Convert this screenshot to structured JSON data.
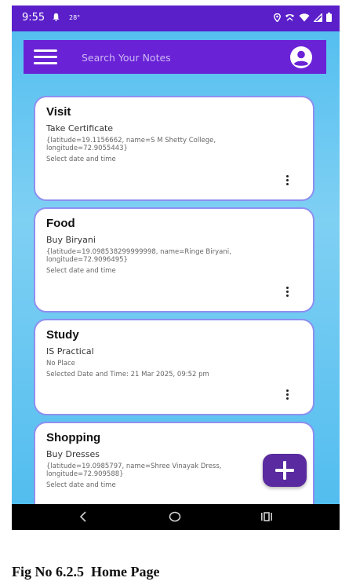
{
  "status_bar": {
    "time": "9:55",
    "temperature": "28°",
    "icons": [
      "bell-icon",
      "location-icon",
      "call-icon",
      "wifi-icon",
      "signal-icon",
      "battery-icon"
    ]
  },
  "topbar": {
    "search_placeholder": "Search Your Notes",
    "menu_icon": "hamburger-menu-icon",
    "account_icon": "account-circle-icon"
  },
  "notes": [
    {
      "title": "Visit",
      "subtitle": "Take Certificate",
      "location": "{latitude=19.1156662, name=S M Shetty College, longitude=72.9055443}",
      "date": "Select date and time"
    },
    {
      "title": "Food",
      "subtitle": "Buy Biryani",
      "location": "{latitude=19.098538299999998, name=Ringe Biryani, longitude=72.9096495}",
      "date": "Select date and time"
    },
    {
      "title": "Study",
      "subtitle": "IS Practical",
      "location": "No Place",
      "date": "Selected Date and Time: 21 Mar 2025, 09:52 pm"
    },
    {
      "title": "Shopping",
      "subtitle": "Buy Dresses",
      "location": "{latitude=19.0985797, name=Shree Vinayak Dress, longitude=72.909588}",
      "date": "Select date and time"
    }
  ],
  "fab": {
    "icon": "plus-icon"
  },
  "nav_bar": {
    "icons": [
      "back-icon",
      "home-icon",
      "recents-icon"
    ]
  },
  "caption": "Fig No 6.2.5  Home Page",
  "colors": {
    "status_bar": "#5a1fc9",
    "topbar": "#6a22d6",
    "background": "#55bff0",
    "card_border": "#8e8ff0",
    "fab": "#5a2ba0"
  }
}
